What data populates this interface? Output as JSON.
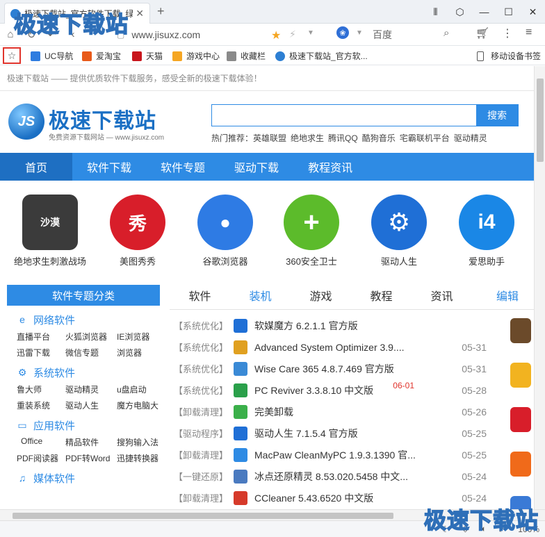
{
  "tab": {
    "title": "极速下载站_官方软件下载_绿色软件下载"
  },
  "address": {
    "url": "www.jisuxz.com",
    "search_engine_label": "百度"
  },
  "bookmarks": {
    "items": [
      {
        "label": "UC导航",
        "color": "#2e7ce0"
      },
      {
        "label": "爱淘宝",
        "color": "#e85a1a"
      },
      {
        "label": "天猫",
        "color": "#c8161d"
      },
      {
        "label": "游戏中心",
        "color": "#f5a623"
      },
      {
        "label": "收藏栏",
        "color": "#8a8a8a"
      },
      {
        "label": "极速下载站_官方软...",
        "color": "#2d7fd3"
      }
    ],
    "mobile": "移动设备书签"
  },
  "page": {
    "tagline": "极速下载站 —— 提供优质软件下载服务，感受全新的极速下载体验！",
    "logo_badge": "JS",
    "logo_title": "极速下载站",
    "logo_sub": "免费资源下载网站 — www.jisuxz.com",
    "search_button": "搜索",
    "hot_label": "热门推荐：",
    "hot_items": [
      "英雄联盟",
      "绝地求生",
      "腾讯QQ",
      "酷狗音乐",
      "宅霸联机平台",
      "驱动精灵"
    ],
    "nav": [
      "首页",
      "软件下载",
      "软件专题",
      "驱动下载",
      "教程资讯"
    ],
    "apps": [
      {
        "name": "绝地求生刺激战场",
        "color": "#3b3b3b",
        "glyph": "沙漠"
      },
      {
        "name": "美图秀秀",
        "color": "#d81e2a",
        "glyph": "秀"
      },
      {
        "name": "谷歌浏览器",
        "color": "#2e7be4",
        "glyph": "●"
      },
      {
        "name": "360安全卫士",
        "color": "#5cbb2b",
        "glyph": "+"
      },
      {
        "name": "驱动人生",
        "color": "#1f6fd6",
        "glyph": "⚙"
      },
      {
        "name": "爱思助手",
        "color": "#1a87e6",
        "glyph": "i4"
      }
    ],
    "category_head": "软件专题分类",
    "categories": [
      {
        "title": "网络软件",
        "icon": "ie-icon",
        "glyph": "e",
        "links": [
          "直播平台",
          "火狐浏览器",
          "IE浏览器",
          "迅雷下载",
          "微信专题",
          "浏览器"
        ]
      },
      {
        "title": "系统软件",
        "icon": "gear-icon",
        "glyph": "⚙",
        "links": [
          "鲁大师",
          "驱动精灵",
          "u盘启动",
          "重装系统",
          "驱动人生",
          "魔方电脑大"
        ]
      },
      {
        "title": "应用软件",
        "icon": "window-icon",
        "glyph": "▭",
        "links": [
          "Office",
          "精品软件",
          "搜狗输入法",
          "PDF阅读器",
          "PDF转Word",
          "迅捷转换器"
        ]
      },
      {
        "title": "媒体软件",
        "icon": "music-icon",
        "glyph": "♫",
        "links": []
      }
    ],
    "tabs": [
      "软件",
      "装机",
      "游戏",
      "教程",
      "资讯"
    ],
    "edit_tab": "编辑",
    "list": [
      {
        "tag": "【系统优化】",
        "name": "软媒魔方 6.2.1.1 官方版",
        "date": "06-01",
        "hot": true,
        "color": "#1f6fd6"
      },
      {
        "tag": "【系统优化】",
        "name": "Advanced System Optimizer 3.9....",
        "date": "05-31",
        "hot": false,
        "color": "#e0a020"
      },
      {
        "tag": "【系统优化】",
        "name": "Wise Care 365 4.8.7.469 官方版",
        "date": "05-31",
        "hot": false,
        "color": "#3a8ad6"
      },
      {
        "tag": "【系统优化】",
        "name": "PC Reviver 3.3.8.10 中文版",
        "date": "05-28",
        "hot": false,
        "color": "#2aa04a"
      },
      {
        "tag": "【卸载清理】",
        "name": "完美卸载",
        "date": "05-26",
        "hot": false,
        "color": "#3bb04a"
      },
      {
        "tag": "【驱动程序】",
        "name": "驱动人生 7.1.5.4 官方版",
        "date": "05-25",
        "hot": false,
        "color": "#1f6fd6"
      },
      {
        "tag": "【卸载清理】",
        "name": "MacPaw CleanMyPC 1.9.3.1390 官...",
        "date": "05-25",
        "hot": false,
        "color": "#2e8be4"
      },
      {
        "tag": "【一键还原】",
        "name": "冰点还原精灵 8.53.020.5458 中文...",
        "date": "05-24",
        "hot": false,
        "color": "#4a7ac0"
      },
      {
        "tag": "【卸载清理】",
        "name": "CCleaner 5.43.6520 中文版",
        "date": "05-24",
        "hot": false,
        "color": "#d63a2a"
      }
    ],
    "side_icon_colors": [
      "#6b4a2a",
      "#f2b320",
      "#d81e2a",
      "#f06a1a",
      "#3a7ad6"
    ]
  },
  "status": {
    "zoom": "100%"
  },
  "watermark": "极速下载站"
}
